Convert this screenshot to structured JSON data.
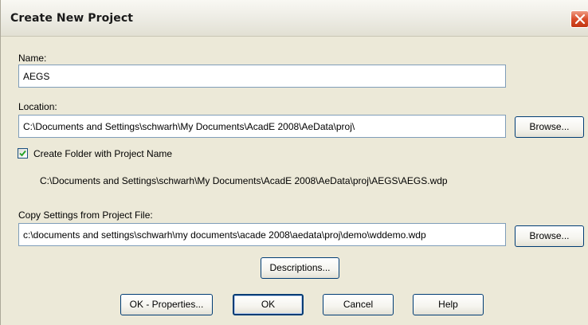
{
  "dialog": {
    "title": "Create New Project",
    "close_icon": "close-icon"
  },
  "name": {
    "label": "Name:",
    "value": "AEGS"
  },
  "location": {
    "label": "Location:",
    "value": "C:\\Documents and Settings\\schwarh\\My Documents\\AcadE 2008\\AeData\\proj\\",
    "browse_label": "Browse..."
  },
  "create_folder": {
    "label": "Create Folder with Project Name",
    "checked": true,
    "resulting_path": "C:\\Documents and Settings\\schwarh\\My Documents\\AcadE 2008\\AeData\\proj\\AEGS\\AEGS.wdp"
  },
  "copy_settings": {
    "label": "Copy Settings from Project File:",
    "value": "c:\\documents and settings\\schwarh\\my documents\\acade 2008\\aedata\\proj\\demo\\wddemo.wdp",
    "browse_label": "Browse..."
  },
  "buttons": {
    "descriptions": "Descriptions...",
    "ok_properties": "OK - Properties...",
    "ok": "OK",
    "cancel": "Cancel",
    "help": "Help"
  },
  "colors": {
    "dialog_background": "#ece9d8",
    "field_border": "#7f9db9",
    "button_border": "#003c74",
    "close_button": "#d94d2b"
  }
}
